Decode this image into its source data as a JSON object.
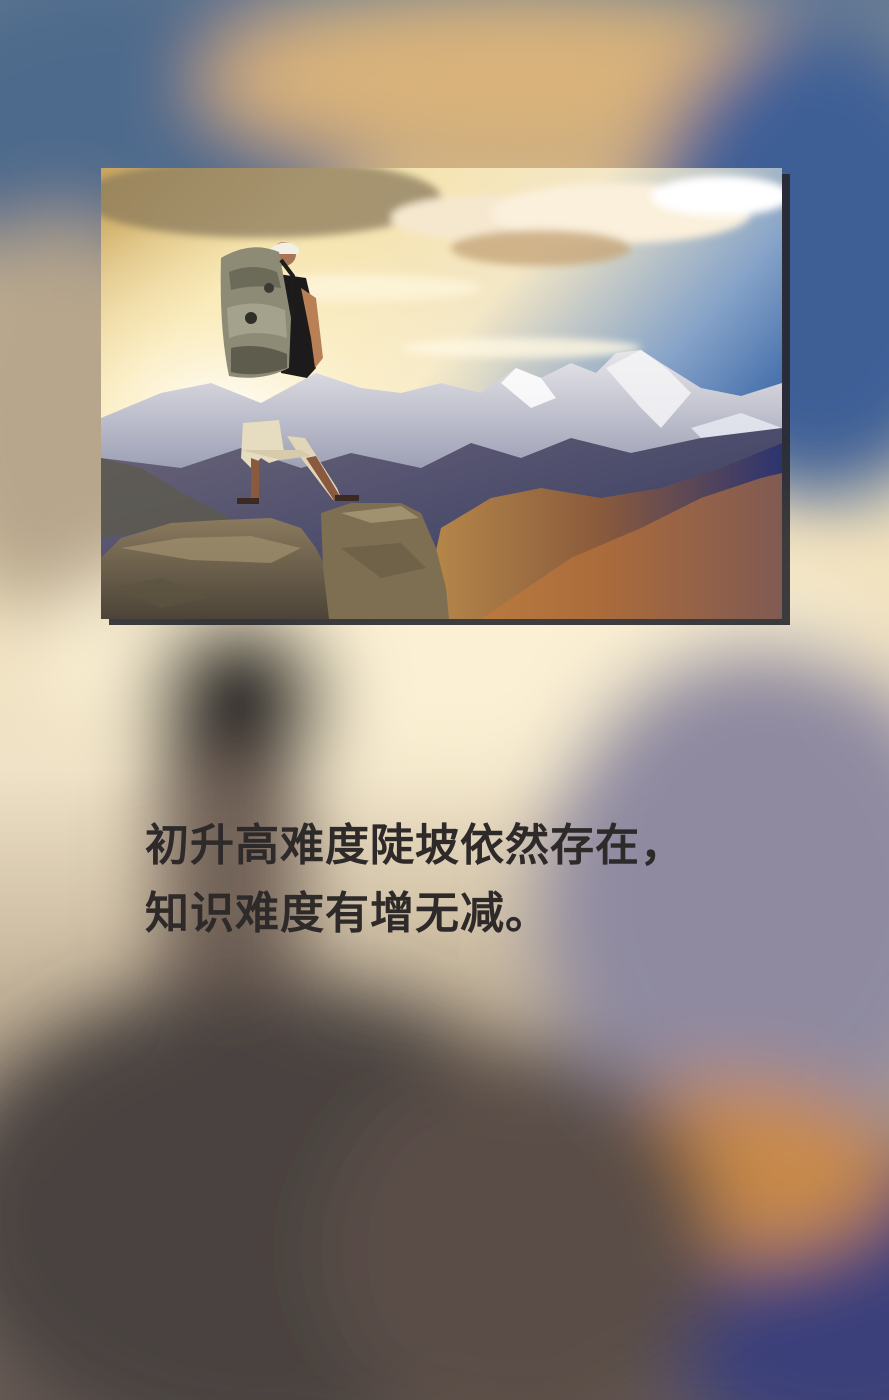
{
  "photo": {
    "subject": "hiker-with-backpack-on-mountain-peak"
  },
  "caption": {
    "line1": "初升高难度陡坡依然存在，",
    "line2": "知识难度有增无减。"
  },
  "colors": {
    "caption_text": "#2e2a2a",
    "frame_shadow": "#28282e",
    "sky_blue": "#3b6aa8",
    "sunlight": "#fbe8b0"
  }
}
